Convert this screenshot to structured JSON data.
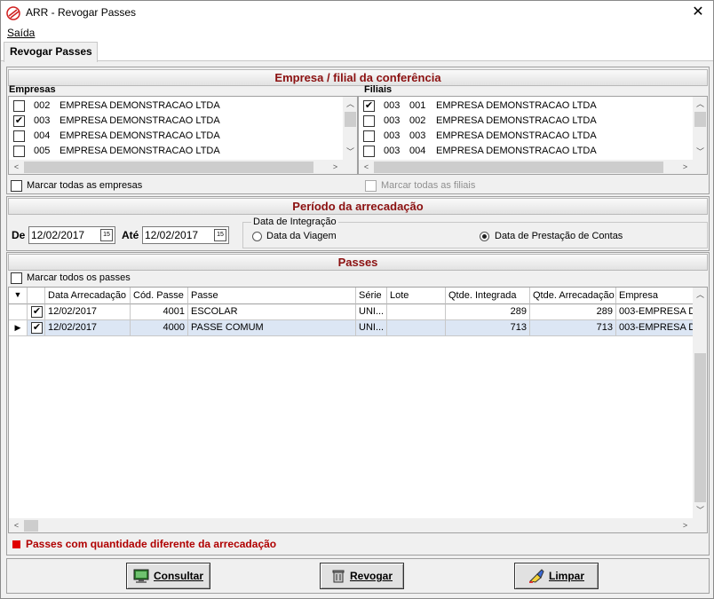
{
  "window": {
    "title": "ARR - Revogar Passes",
    "close_glyph": "✕"
  },
  "menu": {
    "saida": "Saída"
  },
  "tab": {
    "label": "Revogar Passes"
  },
  "empresa_section": {
    "header": "Empresa / filial  da conferência",
    "empresas_label": "Empresas",
    "filiais_label": "Filiais",
    "empresas": [
      {
        "checked": false,
        "code": "002",
        "name": "EMPRESA DEMONSTRACAO LTDA"
      },
      {
        "checked": true,
        "code": "003",
        "name": "EMPRESA DEMONSTRACAO LTDA"
      },
      {
        "checked": false,
        "code": "004",
        "name": "EMPRESA DEMONSTRACAO LTDA"
      },
      {
        "checked": false,
        "code": "005",
        "name": "EMPRESA DEMONSTRACAO LTDA"
      }
    ],
    "filiais": [
      {
        "checked": true,
        "code": "003",
        "filial": "001",
        "name": "EMPRESA DEMONSTRACAO LTDA"
      },
      {
        "checked": false,
        "code": "003",
        "filial": "002",
        "name": "EMPRESA DEMONSTRACAO LTDA"
      },
      {
        "checked": false,
        "code": "003",
        "filial": "003",
        "name": "EMPRESA DEMONSTRACAO LTDA"
      },
      {
        "checked": false,
        "code": "003",
        "filial": "004",
        "name": "EMPRESA DEMONSTRACAO LTDA"
      }
    ],
    "marcar_empresas": "Marcar todas as empresas",
    "marcar_filiais": "Marcar todas as filiais"
  },
  "periodo_section": {
    "header": "Período da arrecadação",
    "de_label": "De",
    "de_value": "12/02/2017",
    "ate_label": "Até",
    "ate_value": "12/02/2017",
    "cal_glyph": "15",
    "integracao_label": "Data de Integração",
    "opt_viagem": "Data da Viagem",
    "opt_prestacao": "Data de Prestação de Contas",
    "selected": "prestacao"
  },
  "passes_section": {
    "header": "Passes",
    "marcar_passes": "Marcar todos os passes",
    "columns": [
      "Data Arrecadação",
      "Cód. Passe",
      "Passe",
      "Série",
      "Lote",
      "Qtde. Integrada",
      "Qtde. Arrecadação",
      "Empresa"
    ],
    "rows": [
      {
        "checked": true,
        "data": "12/02/2017",
        "cod": "4001",
        "passe": "ESCOLAR",
        "serie": "UNI...",
        "lote": "",
        "qtde_integrada": "289",
        "qtde_arrecadacao": "289",
        "empresa": "003-EMPRESA D"
      },
      {
        "checked": true,
        "data": "12/02/2017",
        "cod": "4000",
        "passe": "PASSE COMUM",
        "serie": "UNI...",
        "lote": "",
        "qtde_integrada": "713",
        "qtde_arrecadacao": "713",
        "empresa": "003-EMPRESA D",
        "current": true
      }
    ],
    "legend": "Passes com quantidade diferente da arrecadação",
    "legend_color": "#e00000"
  },
  "buttons": {
    "consultar": "Consultar",
    "revogar": "Revogar",
    "limpar": "Limpar"
  },
  "colors": {
    "header_text": "#8b1010",
    "selected_row": "#dce6f4"
  }
}
